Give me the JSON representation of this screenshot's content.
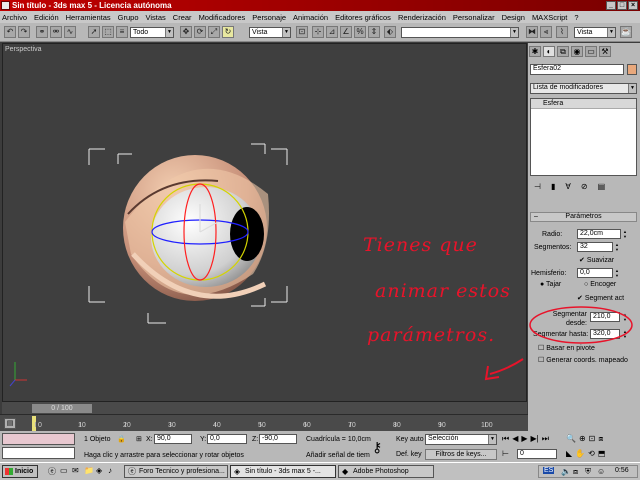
{
  "window": {
    "title": "Sin título - 3ds max 5 - Licencia autónoma"
  },
  "menu": [
    "Archivo",
    "Edición",
    "Herramientas",
    "Grupo",
    "Vistas",
    "Crear",
    "Modificadores",
    "Personaje",
    "Animación",
    "Editores gráficos",
    "Renderización",
    "Personalizar",
    "Design",
    "MAXScript",
    "?"
  ],
  "toolbar": {
    "selection_filter": "Todo",
    "ref_coord": "Vista",
    "named_sel": "",
    "view2": "Vista"
  },
  "viewport": {
    "label": "Perspectiva"
  },
  "command_panel": {
    "object_name": "Esfera02",
    "object_color": "#e8a87c",
    "modifier_list": "Lista de modificadores",
    "stack_item": "Esfera",
    "rollout_title": "Parámetros",
    "params": {
      "radio_label": "Radio:",
      "radio_value": "22,0cm",
      "segmentos_label": "Segmentos:",
      "segmentos_value": "32",
      "suavizar_label": "Suavizar",
      "hemisferio_label": "Hemisferio:",
      "hemisferio_value": "0,0",
      "tajar_label": "Tajar",
      "encoger_label": "Encoger",
      "segment_act_label": "Segment act",
      "seg_desde_label1": "Segmentar",
      "seg_desde_label2": "desde:",
      "seg_desde_value": "210,0",
      "seg_hasta_label": "Segmentar hasta:",
      "seg_hasta_value": "320,0",
      "basar_label": "Basar en pivote",
      "generar_label": "Generar coords. mapeado"
    }
  },
  "annotation": {
    "lines": [
      "Tienes que",
      "animar estos",
      "parámetros."
    ],
    "color": "#e8132a"
  },
  "timeline": {
    "slider_label": "0 / 100",
    "ticks": [
      "0",
      "10",
      "20",
      "30",
      "40",
      "50",
      "60",
      "70",
      "80",
      "90",
      "100"
    ]
  },
  "status": {
    "selected": "1 Objeto",
    "x_label": "X:",
    "x_value": "90,0",
    "y_label": "Y:",
    "y_value": "0,0",
    "z_label": "Z:",
    "z_value": "-90,0",
    "grid": "Cuadrícula = 10,0cm",
    "prompt": "Haga clic y arrastre para seleccionar y rotar objetos",
    "add_key": "Añadir señal de tiem",
    "key_auto": "Key auto",
    "key_mode": "Selección",
    "def_key": "Def. key",
    "key_filters": "Filtros de keys...",
    "frame": "0"
  },
  "taskbar": {
    "start": "Inicio",
    "tasks": [
      "Foro Tecnico y profesiona...",
      "Sin título - 3ds max 5 -...",
      "Adobe Photoshop"
    ],
    "lang": "ES",
    "time": "0:56"
  }
}
